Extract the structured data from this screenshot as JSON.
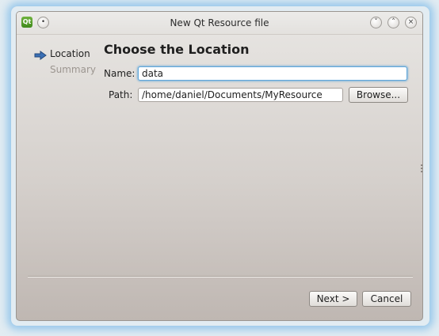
{
  "window": {
    "title": "New Qt Resource file",
    "app_icon_text": "Qt"
  },
  "titlebar_buttons": {
    "menu_glyph": "•",
    "minimize_glyph": "˅",
    "maximize_glyph": "˄",
    "close_glyph": "×"
  },
  "sidebar": {
    "items": [
      {
        "label": "Location",
        "state": "current"
      },
      {
        "label": "Summary",
        "state": "pending"
      }
    ]
  },
  "page": {
    "heading": "Choose the Location"
  },
  "form": {
    "name_label": "Name:",
    "name_value": "data",
    "path_label": "Path:",
    "path_value": "/home/daniel/Documents/MyResource",
    "browse_label": "Browse..."
  },
  "footer": {
    "next_label": "Next >",
    "cancel_label": "Cancel"
  },
  "colors": {
    "focus_ring": "#5fa6da",
    "arrow_icon": "#3a6fb5",
    "inactive_text": "#9c9690"
  }
}
